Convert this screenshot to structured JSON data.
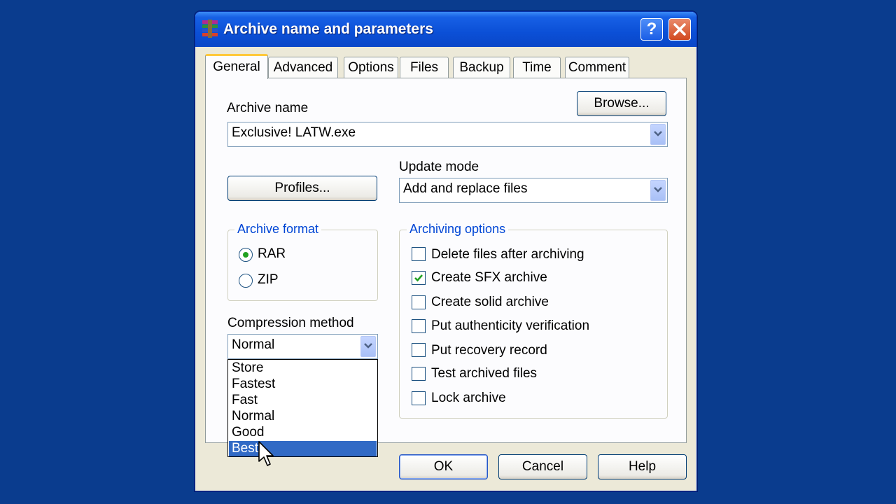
{
  "window": {
    "title": "Archive name and parameters",
    "help_icon": "question-mark-icon",
    "close_icon": "close-icon"
  },
  "tabs": [
    {
      "label": "General",
      "active": true
    },
    {
      "label": "Advanced"
    },
    {
      "label": "Options"
    },
    {
      "label": "Files"
    },
    {
      "label": "Backup"
    },
    {
      "label": "Time"
    },
    {
      "label": "Comment"
    }
  ],
  "general": {
    "archive_name_label": "Archive name",
    "browse_label": "Browse...",
    "archive_name_value": "Exclusive! LATW.exe",
    "profiles_label": "Profiles...",
    "update_mode_label": "Update mode",
    "update_mode_value": "Add and replace files",
    "archive_format": {
      "label": "Archive format",
      "options": [
        "RAR",
        "ZIP"
      ],
      "selected": "RAR"
    },
    "compression": {
      "label": "Compression method",
      "value": "Normal",
      "options": [
        "Store",
        "Fastest",
        "Fast",
        "Normal",
        "Good",
        "Best"
      ],
      "highlighted": "Best"
    },
    "archiving_options": {
      "label": "Archiving options",
      "items": [
        {
          "label": "Delete files after archiving",
          "checked": false
        },
        {
          "label": "Create SFX archive",
          "checked": true
        },
        {
          "label": "Create solid archive",
          "checked": false
        },
        {
          "label": "Put authenticity verification",
          "checked": false
        },
        {
          "label": "Put recovery record",
          "checked": false
        },
        {
          "label": "Test archived files",
          "checked": false
        },
        {
          "label": "Lock archive",
          "checked": false
        }
      ]
    }
  },
  "footer": {
    "ok_label": "OK",
    "cancel_label": "Cancel",
    "help_label": "Help"
  },
  "colors": {
    "desktop": "#0a3c8e",
    "titlebar": "#0b4fd6",
    "selection": "#316ac5",
    "group_label": "#0046d5"
  }
}
